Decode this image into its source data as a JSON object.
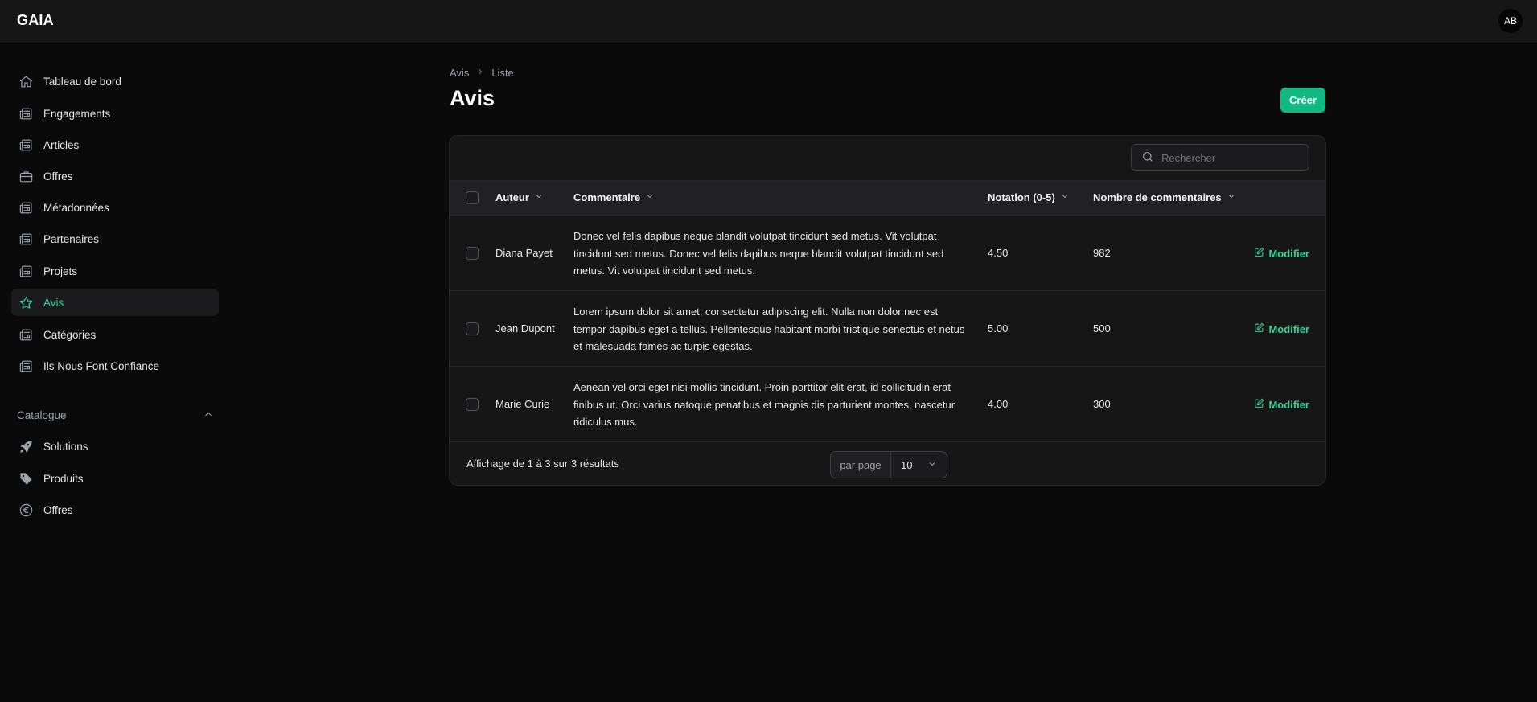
{
  "app": {
    "brand": "GAIA",
    "avatar_initials": "AB"
  },
  "sidebar": {
    "items": [
      {
        "label": "Tableau de bord",
        "icon": "home-icon"
      },
      {
        "label": "Engagements",
        "icon": "newspaper-icon"
      },
      {
        "label": "Articles",
        "icon": "newspaper-icon"
      },
      {
        "label": "Offres",
        "icon": "briefcase-icon"
      },
      {
        "label": "Métadonnées",
        "icon": "newspaper-icon"
      },
      {
        "label": "Partenaires",
        "icon": "newspaper-icon"
      },
      {
        "label": "Projets",
        "icon": "newspaper-icon"
      },
      {
        "label": "Avis",
        "icon": "star-icon",
        "active": true
      },
      {
        "label": "Catégories",
        "icon": "newspaper-icon"
      },
      {
        "label": "Ils Nous Font Confiance",
        "icon": "newspaper-icon"
      }
    ],
    "group_label": "Catalogue",
    "group_items": [
      {
        "label": "Solutions",
        "icon": "rocket-icon"
      },
      {
        "label": "Produits",
        "icon": "tag-icon"
      },
      {
        "label": "Offres",
        "icon": "euro-icon"
      }
    ]
  },
  "breadcrumb": {
    "parent": "Avis",
    "current": "Liste"
  },
  "page": {
    "title": "Avis",
    "create_label": "Créer"
  },
  "table": {
    "search_placeholder": "Rechercher",
    "columns": {
      "author": "Auteur",
      "comment": "Commentaire",
      "rating": "Notation (0-5)",
      "count": "Nombre de commentaires"
    },
    "edit_label": "Modifier",
    "rows": [
      {
        "author": "Diana Payet",
        "comment": "Donec vel felis dapibus neque blandit volutpat tincidunt sed metus. Vit volutpat tincidunt sed metus. Donec vel felis dapibus neque blandit volutpat tincidunt sed metus. Vit volutpat tincidunt sed metus.",
        "rating": "4.50",
        "count": "982"
      },
      {
        "author": "Jean Dupont",
        "comment": "Lorem ipsum dolor sit amet, consectetur adipiscing elit. Nulla non dolor nec est tempor dapibus eget a tellus. Pellentesque habitant morbi tristique senectus et netus et malesuada fames ac turpis egestas.",
        "rating": "5.00",
        "count": "500"
      },
      {
        "author": "Marie Curie",
        "comment": "Aenean vel orci eget nisi mollis tincidunt. Proin porttitor elit erat, id sollicitudin erat finibus ut. Orci varius natoque penatibus et magnis dis parturient montes, nascetur ridiculus mus.",
        "rating": "4.00",
        "count": "300"
      }
    ],
    "footer": {
      "summary": "Affichage de 1 à 3 sur 3 résultats",
      "per_page_label": "par page",
      "per_page_value": "10"
    }
  },
  "colors": {
    "accent": "#10b981",
    "accent_text": "#34d399",
    "background": "#0a0a0b",
    "panel": "#161617"
  }
}
